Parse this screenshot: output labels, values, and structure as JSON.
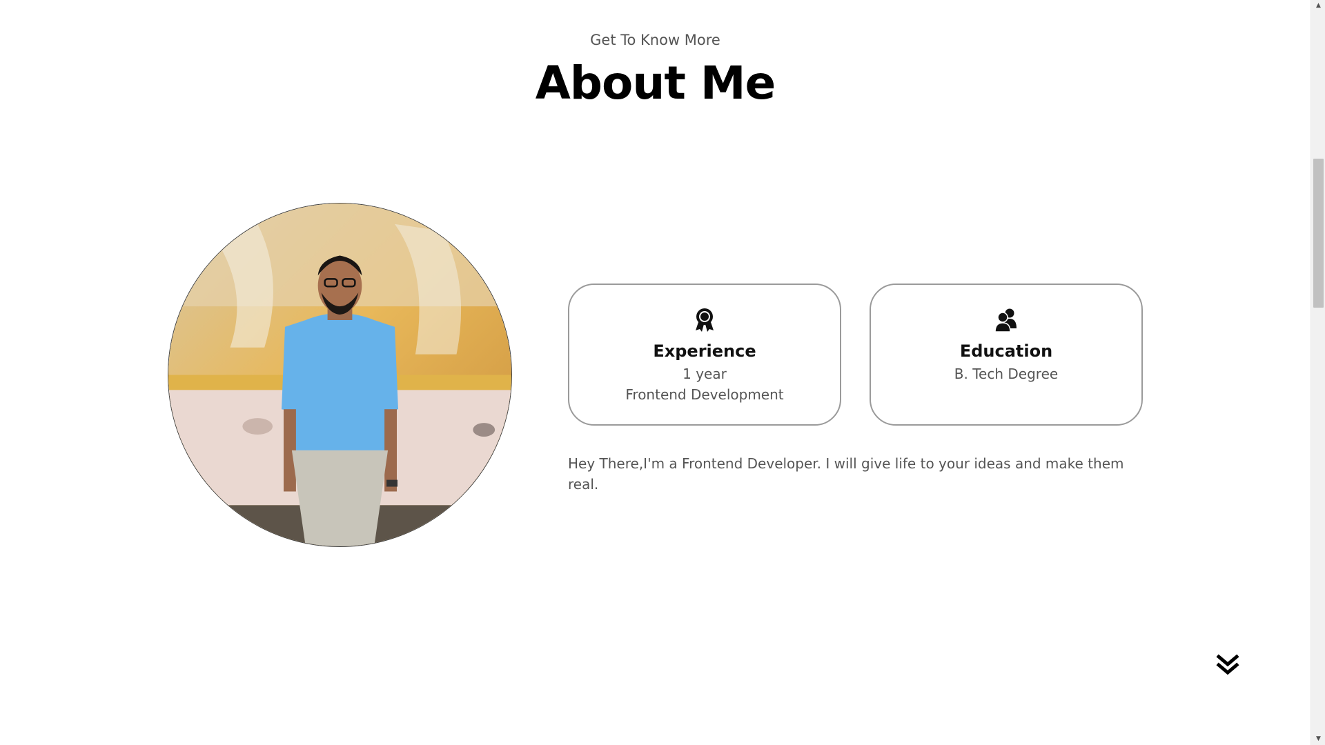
{
  "header": {
    "subtitle": "Get To Know More",
    "title": "About Me"
  },
  "profile_photo": {
    "alt": "Profile picture"
  },
  "cards": {
    "experience": {
      "icon": "experience-award-icon",
      "title": "Experience",
      "line1": "1 year",
      "line2": "Frontend Development"
    },
    "education": {
      "icon": "education-users-icon",
      "title": "Education",
      "line1": "B. Tech Degree"
    }
  },
  "about": {
    "text": "Hey There,I'm a Frontend Developer. I will give life to your ideas and make them real."
  },
  "scroll": {
    "icon": "double-chevron-down-icon"
  }
}
